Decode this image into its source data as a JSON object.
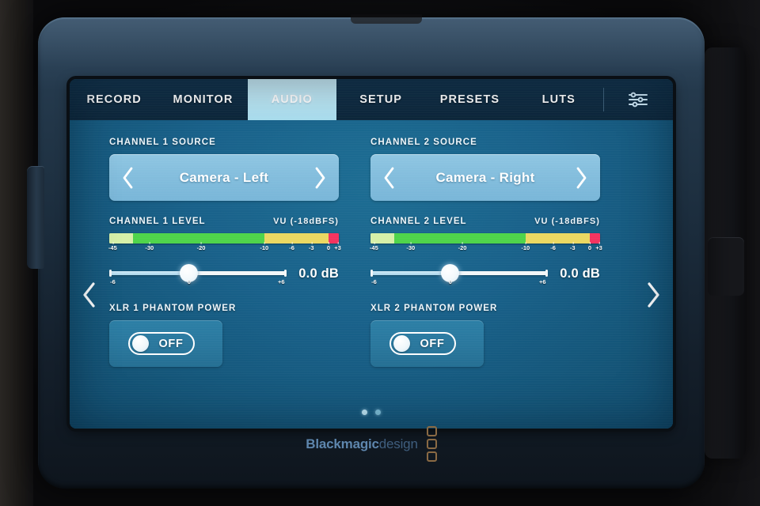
{
  "device": {
    "brand_primary": "Blackmagic",
    "brand_secondary": "design"
  },
  "tabs": [
    {
      "label": "RECORD",
      "active": false
    },
    {
      "label": "MONITOR",
      "active": false
    },
    {
      "label": "AUDIO",
      "active": true
    },
    {
      "label": "SETUP",
      "active": false
    },
    {
      "label": "PRESETS",
      "active": false
    },
    {
      "label": "LUTS",
      "active": false
    }
  ],
  "tab_extra_icon": "sliders-icon",
  "channels": [
    {
      "source_label": "CHANNEL 1 SOURCE",
      "source_value": "Camera - Left",
      "level_label": "CHANNEL 1 LEVEL",
      "vu_label": "VU (-18dBFS)",
      "gain_value": "0.0 dB",
      "gain_min_label": "-6",
      "gain_center_label": "0",
      "gain_max_label": "+6",
      "phantom_label": "XLR 1 PHANTOM POWER",
      "phantom_state": "OFF"
    },
    {
      "source_label": "CHANNEL 2 SOURCE",
      "source_value": "Camera - Right",
      "level_label": "CHANNEL 2 LEVEL",
      "vu_label": "VU (-18dBFS)",
      "gain_value": "0.0 dB",
      "gain_min_label": "-6",
      "gain_center_label": "0",
      "gain_max_label": "+6",
      "phantom_label": "XLR 2 PHANTOM POWER",
      "phantom_state": "OFF"
    }
  ],
  "meter": {
    "scale_ticks": [
      {
        "label": "-45",
        "pos": 1.5
      },
      {
        "label": "-30",
        "pos": 17.5
      },
      {
        "label": "-20",
        "pos": 40.0
      },
      {
        "label": "-10",
        "pos": 67.5
      },
      {
        "label": "-6",
        "pos": 79.5
      },
      {
        "label": "-3",
        "pos": 88.0
      },
      {
        "label": "0",
        "pos": 95.5
      },
      {
        "label": "+3",
        "pos": 99.5
      }
    ],
    "segments": [
      {
        "name": "peak-hold",
        "width_pct": 10.5,
        "color": "#d6f0a8"
      },
      {
        "name": "green-zone",
        "width_pct": 57.0,
        "color": "#4ed44a"
      },
      {
        "name": "yellow-zone",
        "width_pct": 28.0,
        "color": "#ebd861"
      },
      {
        "name": "red-zone",
        "width_pct": 4.5,
        "color": "#f4335f"
      }
    ]
  },
  "slider": {
    "thumb_pct": 45.0,
    "fill_pct": 45.0
  },
  "page_nav": {
    "prev_icon": "chevron-left-icon",
    "next_icon": "chevron-right-icon",
    "dot_count": 2,
    "active_dot": 1
  },
  "colors": {
    "accent": "#bae6f4",
    "panel": "#2a789e",
    "selector": "#84bedd",
    "meter_green": "#4ed44a",
    "meter_yellow": "#ebd861",
    "meter_red": "#f4335f"
  }
}
